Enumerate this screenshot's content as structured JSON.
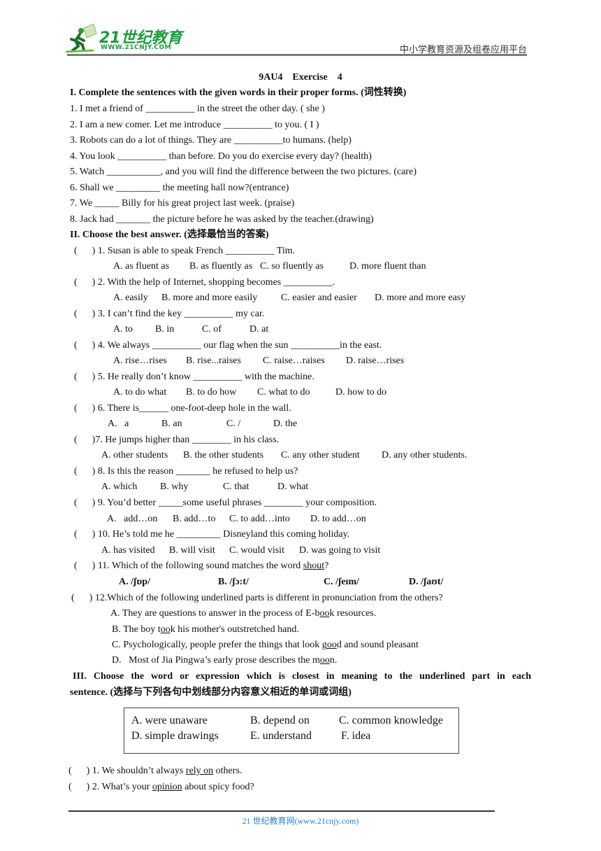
{
  "header": {
    "logo_title": "21世纪教育",
    "logo_url": "WWW.21CNJY.COM",
    "platform": "中小学教育资源及组卷应用平台"
  },
  "title": "9AU4    Exercise    4",
  "section1": {
    "heading": "I. Complete the sentences with the given words in their proper forms. (词性转换)",
    "items": [
      "1. I met a friend of __________ in the street the other day. ( she )",
      "2. I am a new comer. Let me introduce __________ to you. ( I )",
      "3. Robots can do a lot of things. They are __________to humans. (help)",
      "4. You look __________ than before. Do you do exercise every day? (health)",
      "5. Watch ___________, and you will find the difference between the two pictures. (care)",
      "6. Shall we _________ the meeting hall now?(entrance)",
      "7. We _____ Billy for his great project last week. (praise)",
      "8. Jack had _______ the picture before he was asked by the teacher.(drawing)"
    ]
  },
  "section2": {
    "heading": "II. Choose the best answer. (选择最恰当的答案)",
    "paren": "(      )",
    "questions": [
      {
        "q": " 1. Susan is able to speak French __________ Tim.",
        "options": [
          "A. as fluent as",
          "B. as fluently as",
          "C. so fluently as",
          "D. more fluent than"
        ]
      },
      {
        "q": " 2. With the help of Internet, shopping becomes __________.",
        "options": [
          "A. easily",
          "B. more and more easily",
          "C. easier and easier",
          "D. more and more easy"
        ]
      },
      {
        "q": " 3. I can’t find the key __________ my car.",
        "options": [
          "A. to",
          "B. in",
          "C. of",
          "D. at"
        ]
      },
      {
        "q": " 4. We always __________ our flag when the sun __________in the east.",
        "options": [
          "A. rise…rises",
          "B. rise...raises",
          "C. raise…raises",
          "D. raise…rises"
        ]
      },
      {
        "q": " 5. He really don’t know __________ with the machine.",
        "options": [
          "A. to do what",
          "B. to do how",
          "C. what to do",
          "D. how to do"
        ]
      },
      {
        "q": " 6. There is______ one-foot-deep hole in the wall.",
        "options": [
          "A.   a",
          "B. an",
          "C. /",
          "D. the"
        ]
      },
      {
        "q": "7. He jumps higher than ________ in his class.",
        "options": [
          "A. other students",
          "B. the other students",
          "C. any other student",
          "D. any other students."
        ]
      },
      {
        "q": " 8. Is this the reason _______ he refused to help us?",
        "options": [
          "A. which",
          "B. why",
          "C. that",
          "D. what"
        ]
      },
      {
        "q": " 9. You’d better _____some useful phrases ________ your composition.",
        "options": [
          "A.   add…on",
          "B. add…to",
          "C. to add…into",
          "D. to add…on"
        ]
      },
      {
        "q": " 10. He’s told me he _________ Disneyland this coming holiday.",
        "options": [
          "A. has visited",
          "B. will visit",
          "C. would visit",
          "D. was going to visit"
        ]
      },
      {
        "q_pre": " 11. Which of the following sound matches the word ",
        "q_u": "shout",
        "q_post": "?",
        "options": [
          "A. /ʃɒp/",
          "B. /ʃɔ:t/",
          "C. /ʃeɪm/",
          "D. /ʃaʊt/"
        ]
      },
      {
        "q": " 12.Which of the following underlined parts is different in pronunciation from the others?",
        "options_rich": [
          {
            "pre": "A. They are questions to answer in the process of E-b",
            "u": "oo",
            "post": "k resources."
          },
          {
            "pre": "B. The boy t",
            "u": "oo",
            "post": "k his mother's outstretched hand."
          },
          {
            "pre": "C. Psychologically, people prefer the things that look g",
            "u": "oo",
            "post": "d and sound pleasant"
          },
          {
            "pre": "D.   Most of Jia Pingwa’s early prose describes the m",
            "u": "oo",
            "post": "n."
          }
        ]
      }
    ]
  },
  "section3": {
    "heading_line1": "III. Choose the word or expression which is closest in meaning to the underlined part in each",
    "heading_line2_bold": "sentence.",
    "heading_line2_rest": " (选择与下列各句中划线部分内容意义相近的单词或词组)",
    "word_box": [
      "A. were unaware",
      "B. depend on",
      "C. common knowledge",
      "D. simple drawings",
      "E. understand",
      "F. idea"
    ],
    "paren": "(      )",
    "questions": [
      {
        "pre": " 1. We shouldn’t always ",
        "u": "rely on",
        "post": " others."
      },
      {
        "pre": " 2. What’s your ",
        "u": "opinion",
        "post": " about spicy food?"
      }
    ]
  },
  "footer": {
    "text": "21 世纪教育网(www.21cnjy.com)"
  }
}
